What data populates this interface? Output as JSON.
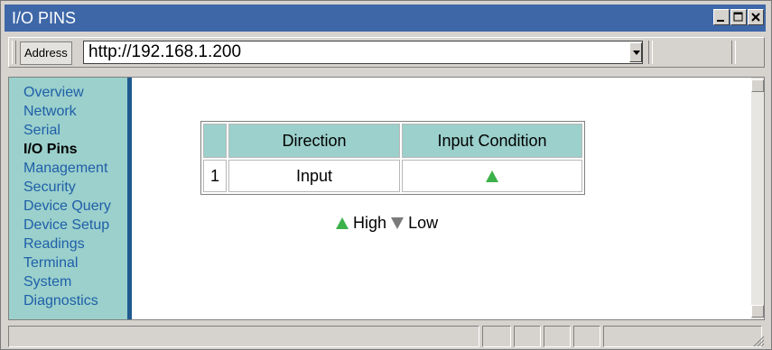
{
  "window": {
    "title": "I/O PINS",
    "buttons": {
      "minimize": "minimize",
      "maximize": "maximize",
      "close": "close"
    }
  },
  "address": {
    "label": "Address",
    "value": "http://192.168.1.200"
  },
  "sidebar": {
    "items": [
      {
        "label": "Overview",
        "active": false
      },
      {
        "label": "Network",
        "active": false
      },
      {
        "label": "Serial",
        "active": false
      },
      {
        "label": "I/O Pins",
        "active": true
      },
      {
        "label": "Management",
        "active": false
      },
      {
        "label": "Security",
        "active": false
      },
      {
        "label": "Device Query",
        "active": false
      },
      {
        "label": "Device  Setup",
        "active": false
      },
      {
        "label": "Readings",
        "active": false
      },
      {
        "label": "Terminal",
        "active": false
      },
      {
        "label": "System",
        "active": false
      },
      {
        "label": "Diagnostics",
        "active": false
      }
    ]
  },
  "table": {
    "headers": [
      "",
      "Direction",
      "Input Condition"
    ],
    "rows": [
      {
        "num": "1",
        "direction": "Input",
        "condition": "high"
      }
    ]
  },
  "legend": {
    "high_label": "High",
    "low_label": "Low"
  },
  "colors": {
    "titlebar": "#3e67a8",
    "sidebar": "#9bd0cc",
    "sidebar_border": "#1f5a8e",
    "link": "#1f5fa8",
    "high": "#3cb24a",
    "low": "#7a7a7a"
  }
}
